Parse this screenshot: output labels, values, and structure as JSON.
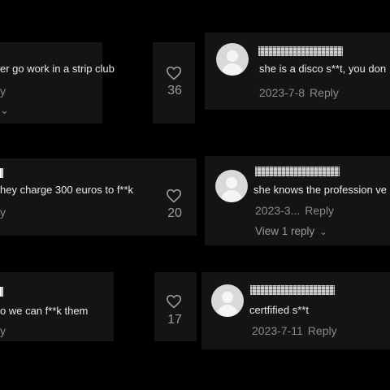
{
  "left_comments": [
    {
      "text": "er go work in a strip club",
      "meta_fragment": "y",
      "chevron": "⌄"
    },
    {
      "text": "hey charge 300 euros to f**k",
      "meta_fragment": "y"
    },
    {
      "text": "o we can f**k them",
      "meta_fragment": "y"
    }
  ],
  "likes": [
    {
      "count": "36",
      "icon": "heart-outline-icon"
    },
    {
      "count": "20",
      "icon": "heart-outline-icon"
    },
    {
      "count": "17",
      "icon": "heart-outline-icon"
    }
  ],
  "replies": [
    {
      "username": "",
      "text": "she is a disco s**t, you don",
      "date": "2023-7-8",
      "reply_label": "Reply",
      "view_replies": ""
    },
    {
      "username": "",
      "text": "she knows the profession ve",
      "date": "2023-3...",
      "reply_label": "Reply",
      "view_replies": "View 1 reply"
    },
    {
      "username": "",
      "text": "certfified s**t",
      "date": "2023-7-11",
      "reply_label": "Reply",
      "view_replies": ""
    }
  ],
  "colors": {
    "background": "#000000",
    "panel": "#141414",
    "text": "#eaeaea",
    "meta": "#8a8a8a"
  }
}
